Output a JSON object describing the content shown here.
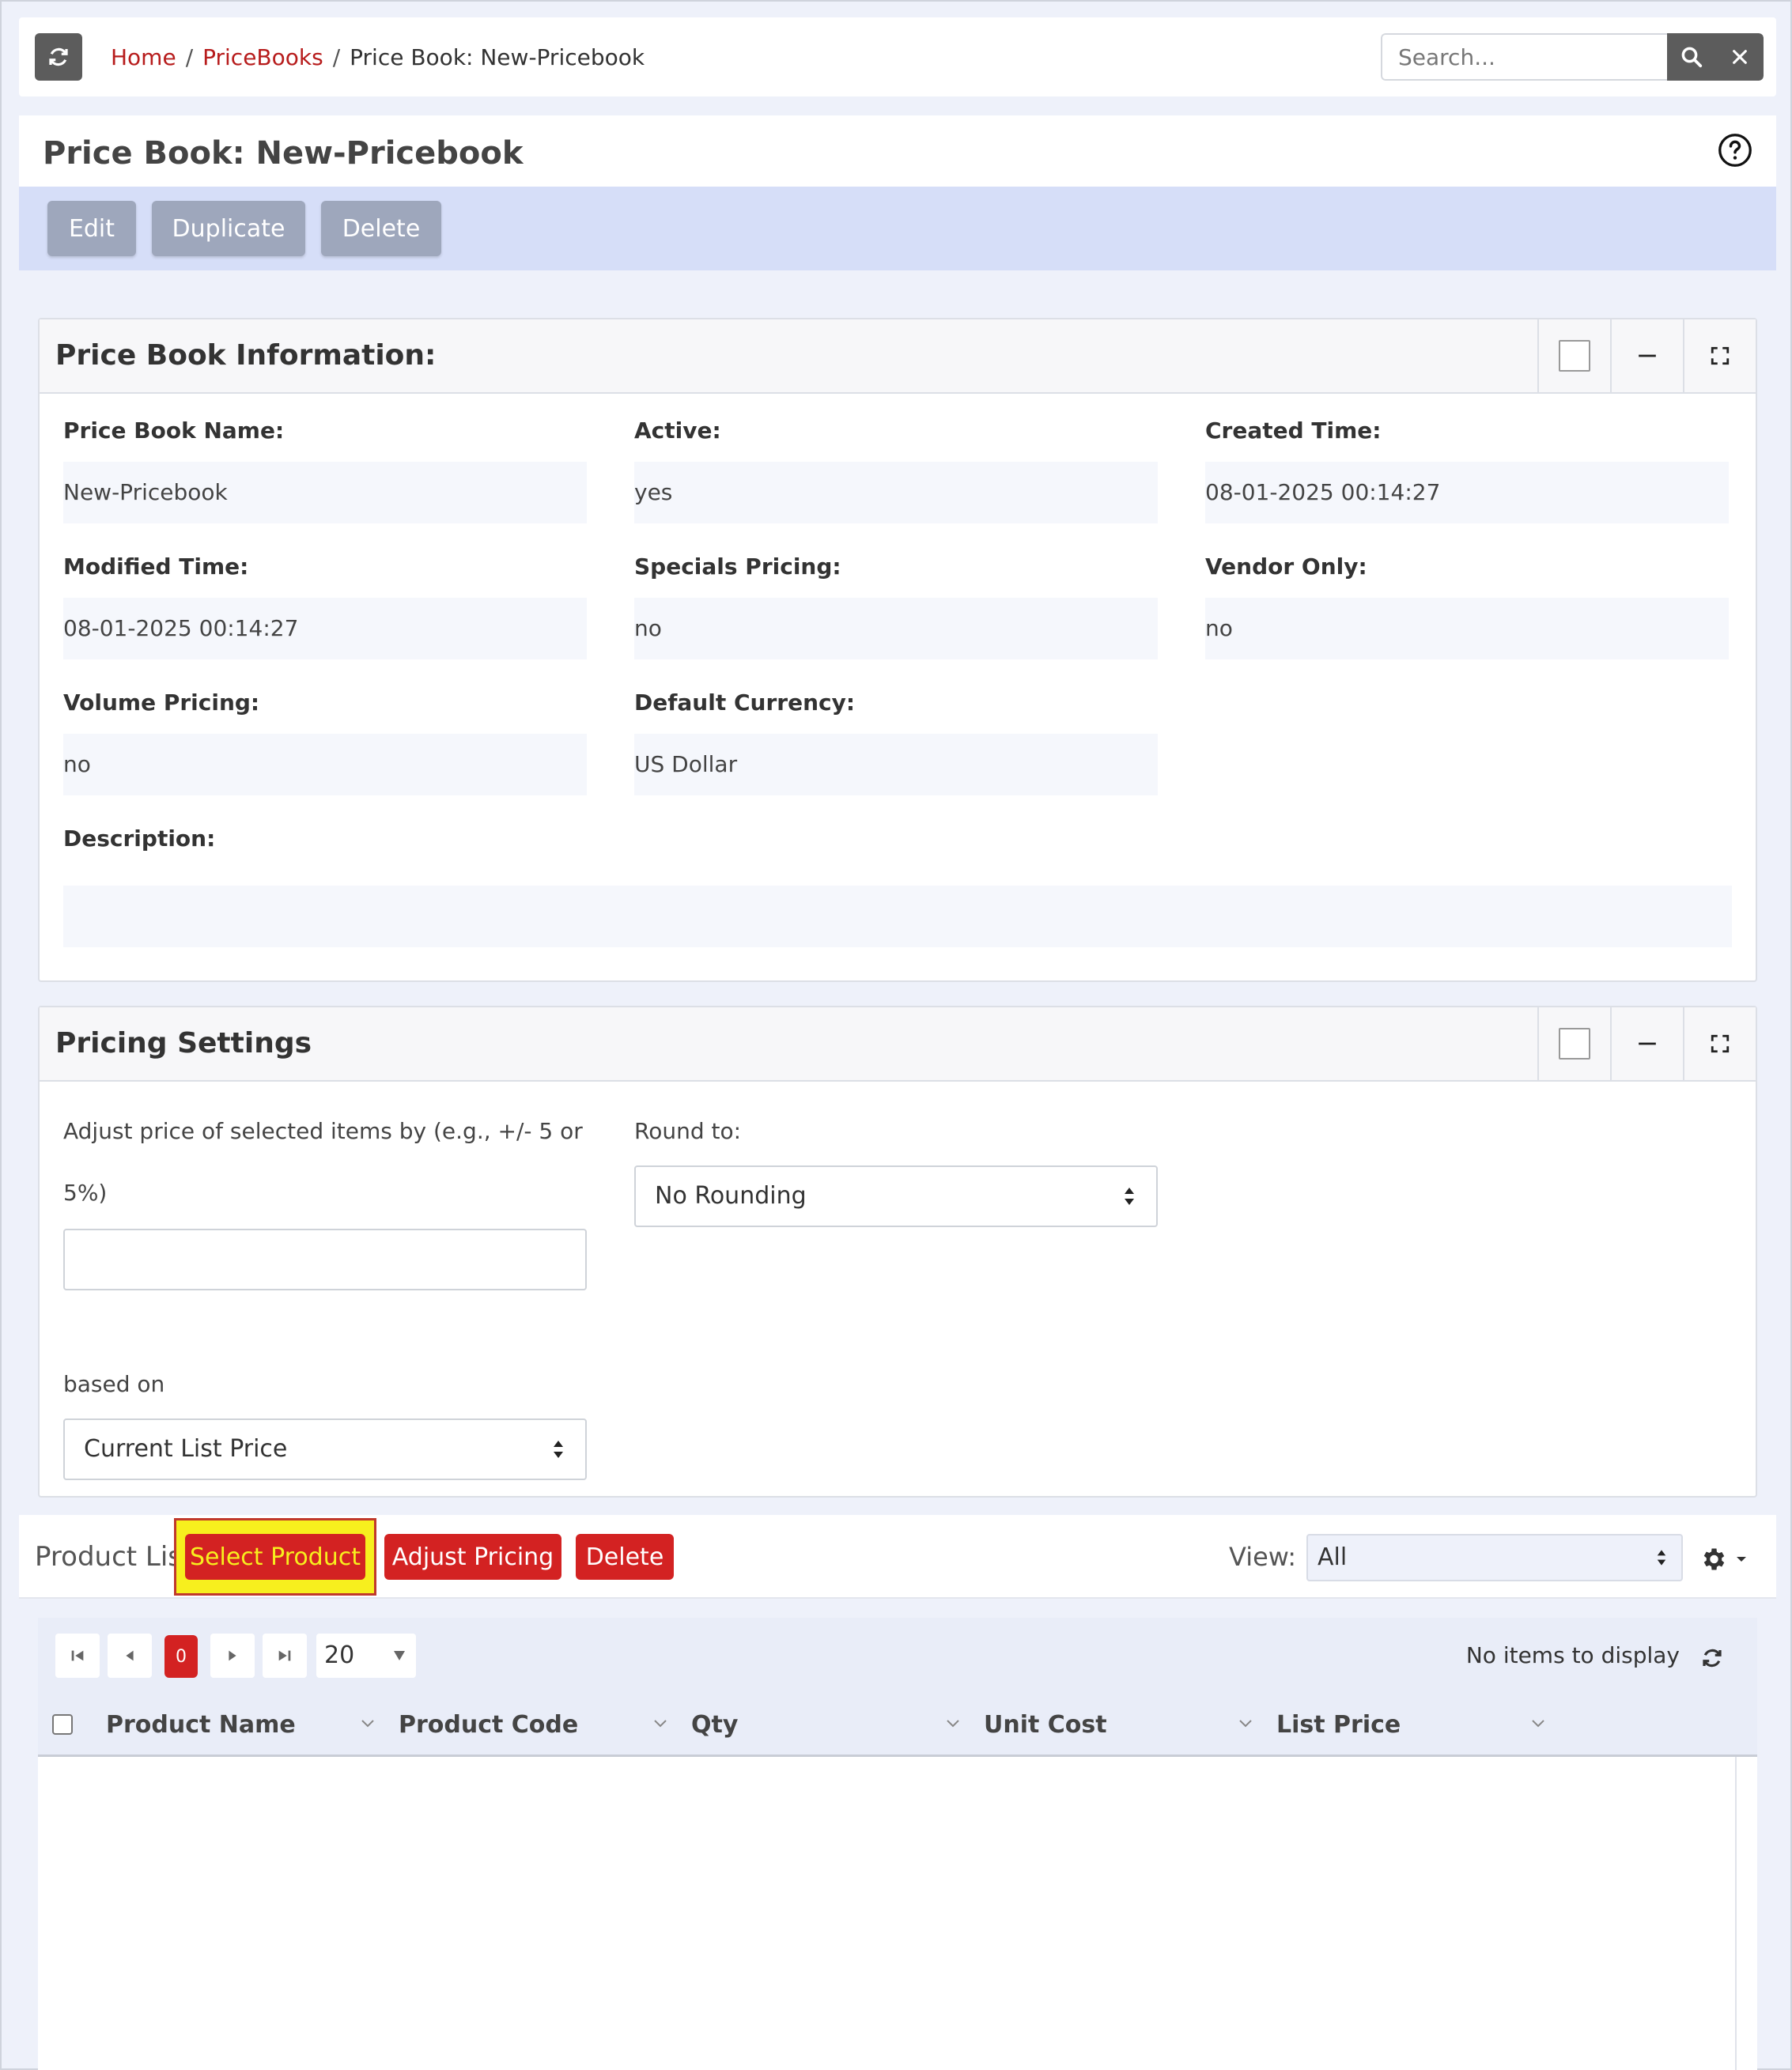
{
  "breadcrumb": {
    "home": "Home",
    "sep1": "/",
    "pricebooks": "PriceBooks",
    "sep2": "/",
    "current": "Price Book: New-Pricebook"
  },
  "search": {
    "placeholder": "Search..."
  },
  "page": {
    "title": "Price Book: New-Pricebook"
  },
  "actions": {
    "edit": "Edit",
    "duplicate": "Duplicate",
    "delete": "Delete"
  },
  "info_panel": {
    "title": "Price Book Information:",
    "fields": {
      "name": {
        "label": "Price Book Name:",
        "value": "New-Pricebook"
      },
      "active": {
        "label": "Active:",
        "value": "yes"
      },
      "created": {
        "label": "Created Time:",
        "value": "08-01-2025 00:14:27"
      },
      "modified": {
        "label": "Modified Time:",
        "value": "08-01-2025 00:14:27"
      },
      "specials": {
        "label": "Specials Pricing:",
        "value": "no"
      },
      "vendor_only": {
        "label": "Vendor Only:",
        "value": "no"
      },
      "volume": {
        "label": "Volume Pricing:",
        "value": "no"
      },
      "currency": {
        "label": "Default Currency:",
        "value": "US Dollar"
      },
      "description": {
        "label": "Description:",
        "value": ""
      }
    }
  },
  "pricing_panel": {
    "title": "Pricing Settings",
    "adjust_label_line1": "Adjust price of selected items by (e.g., +/- 5 or",
    "adjust_label_line2": "5%)",
    "adjust_value": "",
    "round_label": "Round to:",
    "round_value": "No Rounding",
    "based_on_label": "based on",
    "based_on_value": "Current List Price"
  },
  "product_list": {
    "title": "Product List",
    "select_product": "Select Product",
    "adjust_pricing": "Adjust Pricing",
    "delete": "Delete",
    "view_label": "View:",
    "view_value": "All"
  },
  "grid": {
    "current_page": "0",
    "page_size": "20",
    "info": "No items to display",
    "columns": [
      "Product Name",
      "Product Code",
      "Qty",
      "Unit Cost",
      "List Price"
    ]
  },
  "colors": {
    "accent_red": "#d32222",
    "link_red": "#b71c1c",
    "highlight": "#f7ef1e",
    "action_bar": "#d6def8"
  }
}
